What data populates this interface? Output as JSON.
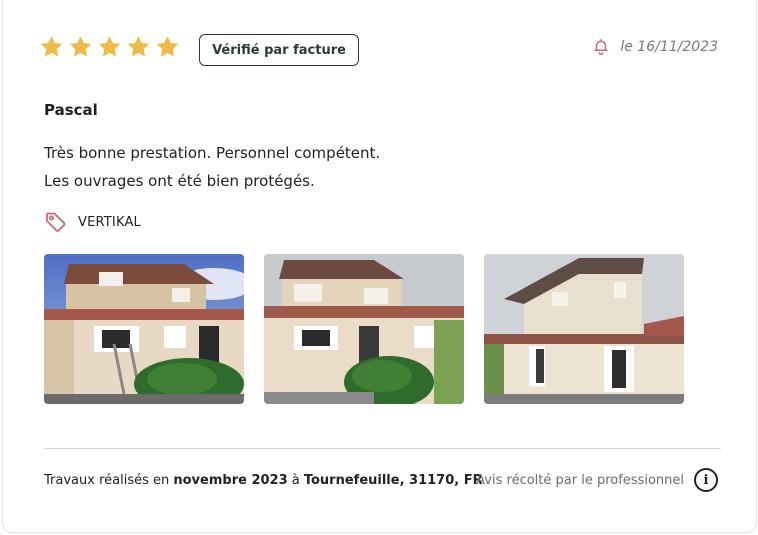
{
  "review": {
    "rating": 5,
    "rating_max": 5,
    "verified_label": "Vérifié par facture",
    "date": "le 16/11/2023",
    "author": "Pascal",
    "text_lines": [
      "Très bonne prestation. Personnel compétent.",
      "Les ouvrages ont été bien protégés."
    ],
    "company": "VERTIKAL",
    "photo_count": 3
  },
  "footer": {
    "works_prefix": "Travaux réalisés en ",
    "works_month": "novembre 2023",
    "works_mid": " à ",
    "works_location": "Tournefeuille, 31170, FR",
    "collected_label": "Avis récolté par le professionnel",
    "info_glyph": "i"
  },
  "colors": {
    "star": "#EFBA45",
    "accent_pink": "#D2677A",
    "border_dark": "#2D3A3A"
  },
  "icons": {
    "star": "star-icon",
    "bell": "bell-icon",
    "tag": "tag-icon",
    "info": "info-icon"
  }
}
